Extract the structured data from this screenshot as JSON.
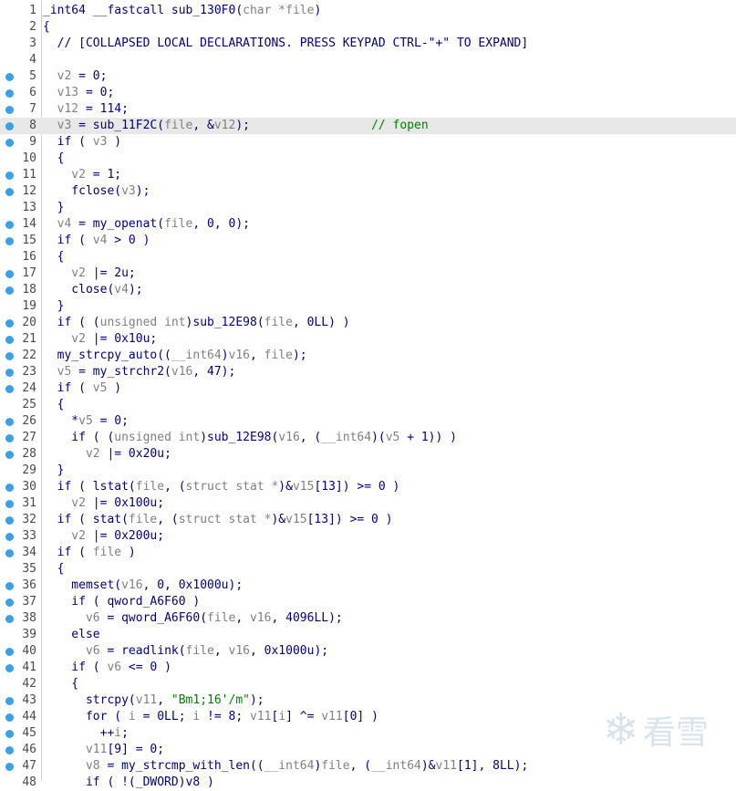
{
  "editor": {
    "lines": [
      {
        "n": "1",
        "dot": false,
        "hl": false,
        "t": [
          [
            "c",
            "_int64 __fastcall sub_130F0("
          ],
          [
            "g",
            "char *file"
          ],
          [
            "c",
            ")"
          ]
        ]
      },
      {
        "n": "2",
        "dot": false,
        "hl": false,
        "t": [
          [
            "c",
            "{"
          ]
        ]
      },
      {
        "n": "3",
        "dot": false,
        "hl": false,
        "t": [
          [
            "c",
            "  // [COLLAPSED LOCAL DECLARATIONS. PRESS KEYPAD CTRL-\"+\" TO EXPAND]"
          ]
        ]
      },
      {
        "n": "4",
        "dot": false,
        "hl": false,
        "t": []
      },
      {
        "n": "5",
        "dot": true,
        "hl": false,
        "t": [
          [
            "g",
            "  v2"
          ],
          [
            "c",
            " = 0;"
          ]
        ]
      },
      {
        "n": "6",
        "dot": true,
        "hl": false,
        "t": [
          [
            "g",
            "  v13"
          ],
          [
            "c",
            " = 0;"
          ]
        ]
      },
      {
        "n": "7",
        "dot": true,
        "hl": false,
        "t": [
          [
            "g",
            "  v12"
          ],
          [
            "c",
            " = 114;"
          ]
        ]
      },
      {
        "n": "8",
        "dot": true,
        "hl": true,
        "t": [
          [
            "g",
            "  v3"
          ],
          [
            "c",
            " = sub_11F2C("
          ],
          [
            "g",
            "file"
          ],
          [
            "c",
            ", &"
          ],
          [
            "g",
            "v12"
          ],
          [
            "c",
            ");"
          ],
          [
            "c",
            "                 "
          ],
          [
            "m",
            "// fopen"
          ]
        ]
      },
      {
        "n": "9",
        "dot": true,
        "hl": false,
        "t": [
          [
            "c",
            "  if ( "
          ],
          [
            "g",
            "v3"
          ],
          [
            "c",
            " )"
          ]
        ]
      },
      {
        "n": "10",
        "dot": false,
        "hl": false,
        "t": [
          [
            "c",
            "  {"
          ]
        ]
      },
      {
        "n": "11",
        "dot": true,
        "hl": false,
        "t": [
          [
            "g",
            "    v2"
          ],
          [
            "c",
            " = 1;"
          ]
        ]
      },
      {
        "n": "12",
        "dot": true,
        "hl": false,
        "t": [
          [
            "c",
            "    fclose("
          ],
          [
            "g",
            "v3"
          ],
          [
            "c",
            ");"
          ]
        ]
      },
      {
        "n": "13",
        "dot": false,
        "hl": false,
        "t": [
          [
            "c",
            "  }"
          ]
        ]
      },
      {
        "n": "14",
        "dot": true,
        "hl": false,
        "t": [
          [
            "g",
            "  v4"
          ],
          [
            "c",
            " = my_openat("
          ],
          [
            "g",
            "file"
          ],
          [
            "c",
            ", 0, 0);"
          ]
        ]
      },
      {
        "n": "15",
        "dot": true,
        "hl": false,
        "t": [
          [
            "c",
            "  if ( "
          ],
          [
            "g",
            "v4"
          ],
          [
            "c",
            " > 0 )"
          ]
        ]
      },
      {
        "n": "16",
        "dot": false,
        "hl": false,
        "t": [
          [
            "c",
            "  {"
          ]
        ]
      },
      {
        "n": "17",
        "dot": true,
        "hl": false,
        "t": [
          [
            "g",
            "    v2"
          ],
          [
            "c",
            " |= 2u;"
          ]
        ]
      },
      {
        "n": "18",
        "dot": true,
        "hl": false,
        "t": [
          [
            "c",
            "    close("
          ],
          [
            "g",
            "v4"
          ],
          [
            "c",
            ");"
          ]
        ]
      },
      {
        "n": "19",
        "dot": false,
        "hl": false,
        "t": [
          [
            "c",
            "  }"
          ]
        ]
      },
      {
        "n": "20",
        "dot": true,
        "hl": false,
        "t": [
          [
            "c",
            "  if ( ("
          ],
          [
            "g",
            "unsigned int"
          ],
          [
            "c",
            ")sub_12E98("
          ],
          [
            "g",
            "file"
          ],
          [
            "c",
            ", 0LL) )"
          ]
        ]
      },
      {
        "n": "21",
        "dot": true,
        "hl": false,
        "t": [
          [
            "g",
            "    v2"
          ],
          [
            "c",
            " |= 0x10u;"
          ]
        ]
      },
      {
        "n": "22",
        "dot": true,
        "hl": false,
        "t": [
          [
            "c",
            "  my_strcpy_auto(("
          ],
          [
            "g",
            "__int64"
          ],
          [
            "c",
            ")"
          ],
          [
            "g",
            "v16"
          ],
          [
            "c",
            ", "
          ],
          [
            "g",
            "file"
          ],
          [
            "c",
            ");"
          ]
        ]
      },
      {
        "n": "23",
        "dot": true,
        "hl": false,
        "t": [
          [
            "g",
            "  v5"
          ],
          [
            "c",
            " = my_strchr2("
          ],
          [
            "g",
            "v16"
          ],
          [
            "c",
            ", 47);"
          ]
        ]
      },
      {
        "n": "24",
        "dot": true,
        "hl": false,
        "t": [
          [
            "c",
            "  if ( "
          ],
          [
            "g",
            "v5"
          ],
          [
            "c",
            " )"
          ]
        ]
      },
      {
        "n": "25",
        "dot": false,
        "hl": false,
        "t": [
          [
            "c",
            "  {"
          ]
        ]
      },
      {
        "n": "26",
        "dot": true,
        "hl": false,
        "t": [
          [
            "c",
            "    *"
          ],
          [
            "g",
            "v5"
          ],
          [
            "c",
            " = 0;"
          ]
        ]
      },
      {
        "n": "27",
        "dot": true,
        "hl": false,
        "t": [
          [
            "c",
            "    if ( ("
          ],
          [
            "g",
            "unsigned int"
          ],
          [
            "c",
            ")sub_12E98("
          ],
          [
            "g",
            "v16"
          ],
          [
            "c",
            ", ("
          ],
          [
            "g",
            "__int64"
          ],
          [
            "c",
            ")("
          ],
          [
            "g",
            "v5"
          ],
          [
            "c",
            " + 1)) )"
          ]
        ]
      },
      {
        "n": "28",
        "dot": true,
        "hl": false,
        "t": [
          [
            "g",
            "      v2"
          ],
          [
            "c",
            " |= 0x20u;"
          ]
        ]
      },
      {
        "n": "29",
        "dot": false,
        "hl": false,
        "t": [
          [
            "c",
            "  }"
          ]
        ]
      },
      {
        "n": "30",
        "dot": true,
        "hl": false,
        "t": [
          [
            "c",
            "  if ( lstat("
          ],
          [
            "g",
            "file"
          ],
          [
            "c",
            ", ("
          ],
          [
            "g",
            "struct stat *"
          ],
          [
            "c",
            ")&"
          ],
          [
            "g",
            "v15"
          ],
          [
            "c",
            "[13]) >= 0 )"
          ]
        ]
      },
      {
        "n": "31",
        "dot": true,
        "hl": false,
        "t": [
          [
            "g",
            "    v2"
          ],
          [
            "c",
            " |= 0x100u;"
          ]
        ]
      },
      {
        "n": "32",
        "dot": true,
        "hl": false,
        "t": [
          [
            "c",
            "  if ( stat("
          ],
          [
            "g",
            "file"
          ],
          [
            "c",
            ", ("
          ],
          [
            "g",
            "struct stat *"
          ],
          [
            "c",
            ")&"
          ],
          [
            "g",
            "v15"
          ],
          [
            "c",
            "[13]) >= 0 )"
          ]
        ]
      },
      {
        "n": "33",
        "dot": true,
        "hl": false,
        "t": [
          [
            "g",
            "    v2"
          ],
          [
            "c",
            " |= 0x200u;"
          ]
        ]
      },
      {
        "n": "34",
        "dot": true,
        "hl": false,
        "t": [
          [
            "c",
            "  if ( "
          ],
          [
            "g",
            "file"
          ],
          [
            "c",
            " )"
          ]
        ]
      },
      {
        "n": "35",
        "dot": false,
        "hl": false,
        "t": [
          [
            "c",
            "  {"
          ]
        ]
      },
      {
        "n": "36",
        "dot": true,
        "hl": false,
        "t": [
          [
            "c",
            "    memset("
          ],
          [
            "g",
            "v16"
          ],
          [
            "c",
            ", 0, 0x1000u);"
          ]
        ]
      },
      {
        "n": "37",
        "dot": true,
        "hl": false,
        "t": [
          [
            "c",
            "    if ( qword_A6F60 )"
          ]
        ]
      },
      {
        "n": "38",
        "dot": true,
        "hl": false,
        "t": [
          [
            "g",
            "      v6"
          ],
          [
            "c",
            " = qword_A6F60("
          ],
          [
            "g",
            "file"
          ],
          [
            "c",
            ", "
          ],
          [
            "g",
            "v16"
          ],
          [
            "c",
            ", 4096LL);"
          ]
        ]
      },
      {
        "n": "39",
        "dot": false,
        "hl": false,
        "t": [
          [
            "c",
            "    else"
          ]
        ]
      },
      {
        "n": "40",
        "dot": true,
        "hl": false,
        "t": [
          [
            "g",
            "      v6"
          ],
          [
            "c",
            " = readlink("
          ],
          [
            "g",
            "file"
          ],
          [
            "c",
            ", "
          ],
          [
            "g",
            "v16"
          ],
          [
            "c",
            ", 0x1000u);"
          ]
        ]
      },
      {
        "n": "41",
        "dot": true,
        "hl": false,
        "t": [
          [
            "c",
            "    if ( "
          ],
          [
            "g",
            "v6"
          ],
          [
            "c",
            " <= 0 )"
          ]
        ]
      },
      {
        "n": "42",
        "dot": false,
        "hl": false,
        "t": [
          [
            "c",
            "    {"
          ]
        ]
      },
      {
        "n": "43",
        "dot": true,
        "hl": false,
        "t": [
          [
            "c",
            "      strcpy("
          ],
          [
            "g",
            "v11"
          ],
          [
            "c",
            ", "
          ],
          [
            "s",
            "\"Bm1;16'/m\""
          ],
          [
            "c",
            ");"
          ]
        ]
      },
      {
        "n": "44",
        "dot": true,
        "hl": false,
        "t": [
          [
            "c",
            "      for ( "
          ],
          [
            "g",
            "i"
          ],
          [
            "c",
            " = 0LL; "
          ],
          [
            "g",
            "i"
          ],
          [
            "c",
            " != 8; "
          ],
          [
            "g",
            "v11"
          ],
          [
            "c",
            "["
          ],
          [
            "g",
            "i"
          ],
          [
            "c",
            "] ^= "
          ],
          [
            "g",
            "v11"
          ],
          [
            "c",
            "[0] )"
          ]
        ]
      },
      {
        "n": "45",
        "dot": true,
        "hl": false,
        "t": [
          [
            "c",
            "        ++"
          ],
          [
            "g",
            "i"
          ],
          [
            "c",
            ";"
          ]
        ]
      },
      {
        "n": "46",
        "dot": true,
        "hl": false,
        "t": [
          [
            "g",
            "      v11"
          ],
          [
            "c",
            "[9] = 0;"
          ]
        ]
      },
      {
        "n": "47",
        "dot": true,
        "hl": false,
        "t": [
          [
            "g",
            "      v8"
          ],
          [
            "c",
            " = my_strcmp_with_len(("
          ],
          [
            "g",
            "__int64"
          ],
          [
            "c",
            ")"
          ],
          [
            "g",
            "file"
          ],
          [
            "c",
            ", ("
          ],
          [
            "g",
            "__int64"
          ],
          [
            "c",
            ")&"
          ],
          [
            "g",
            "v11"
          ],
          [
            "c",
            "[1], 8LL);"
          ]
        ]
      },
      {
        "n": "48",
        "dot": false,
        "hl": false,
        "t": [
          [
            "c",
            "      if ( !(_DWORD)v8 )"
          ]
        ]
      }
    ]
  },
  "colors": {
    "c": "#000080",
    "g": "#808080",
    "s": "#008000",
    "m": "#008000",
    "lineno": "#4a4a4a",
    "dot": "#3aa0e8",
    "highlight": "#e8e8e8"
  },
  "watermark": {
    "text": "看雪",
    "icon": "snowflake-icon"
  }
}
